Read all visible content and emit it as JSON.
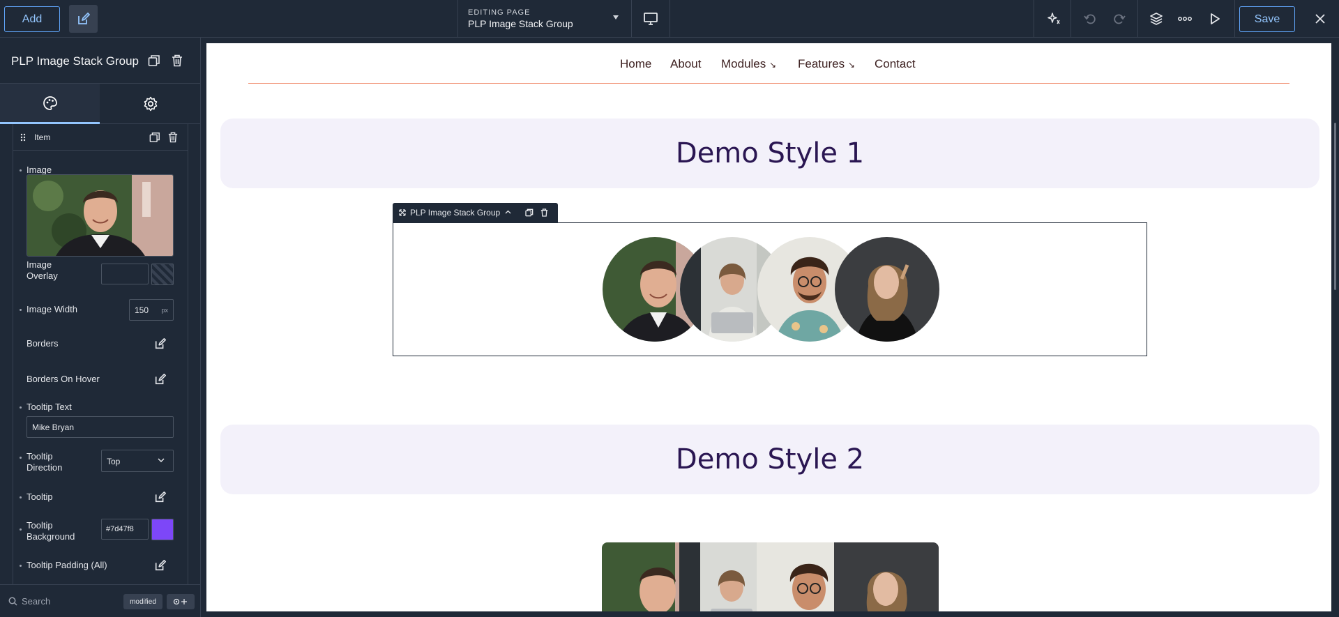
{
  "toolbar": {
    "add_label": "Add",
    "editing_label": "EDITING PAGE",
    "page_name": "PLP Image Stack Group",
    "save_label": "Save",
    "icons": [
      "edit-icon",
      "desktop-icon",
      "sparkle-icon",
      "undo-icon",
      "redo-icon",
      "layers-icon",
      "more-icon",
      "play-icon",
      "close-icon"
    ]
  },
  "sidebar": {
    "title": "PLP Image Stack Group",
    "tabs": [
      "style",
      "settings"
    ],
    "item_label": "Item",
    "fields": {
      "image": "Image",
      "image_overlay": "Image Overlay",
      "image_width": "Image Width",
      "image_width_value": "150",
      "image_width_unit": "px",
      "borders": "Borders",
      "borders_hover": "Borders On Hover",
      "tooltip_text": "Tooltip Text",
      "tooltip_text_value": "Mike Bryan",
      "tooltip_direction": "Tooltip Direction",
      "tooltip_direction_value": "Top",
      "tooltip": "Tooltip",
      "tooltip_background": "Tooltip Background",
      "tooltip_background_value": "#7d47f8",
      "tooltip_padding": "Tooltip Padding (All)"
    },
    "footer": {
      "search_placeholder": "Search",
      "modified_label": "modified"
    }
  },
  "canvas": {
    "nav": [
      "Home",
      "About",
      "Modules",
      "Features",
      "Contact"
    ],
    "nav_arrows": [
      "↘",
      "↘"
    ],
    "demo1_title": "Demo Style 1",
    "demo2_title": "Demo Style 2",
    "selection_label": "PLP Image Stack Group"
  },
  "colors": {
    "accent": "#93c5fd",
    "tooltip_bg": "#7d47f8",
    "banner_bg": "#f3f1fa",
    "banner_text": "#2a1652"
  }
}
